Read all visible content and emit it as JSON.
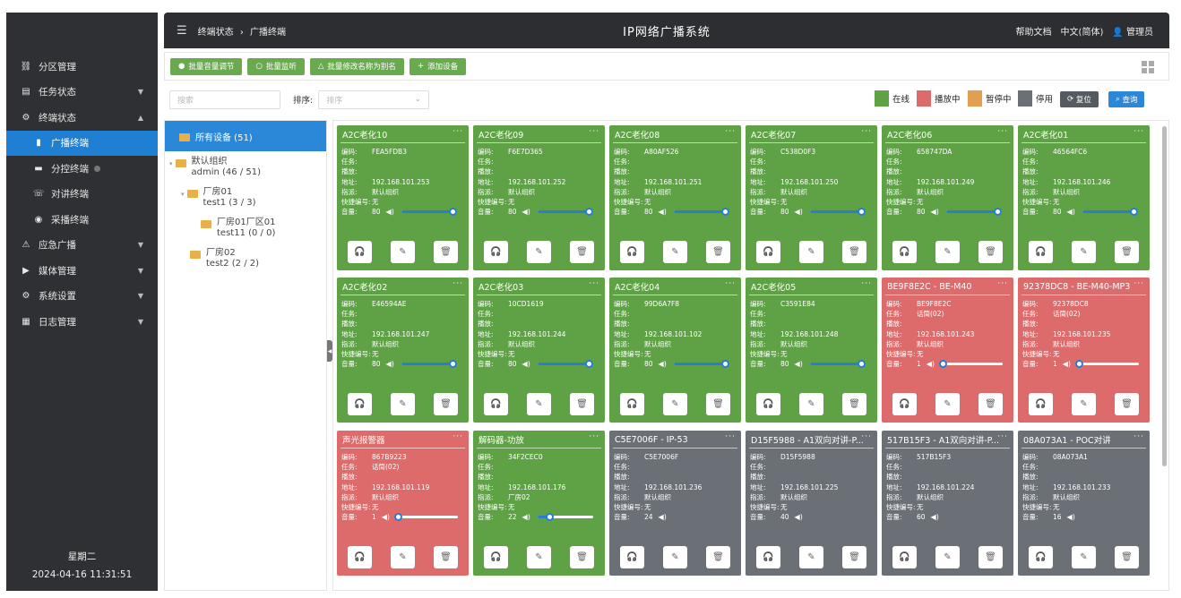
{
  "header": {
    "breadcrumb": [
      "终端状态",
      "广播终端"
    ],
    "separator": "›",
    "title": "IP网络广播系统",
    "help": "帮助文档",
    "language": "中文(简体)",
    "user": "管理员"
  },
  "sidebar": {
    "items": [
      {
        "label": "分区管理",
        "icon": "link-icon"
      },
      {
        "label": "任务状态",
        "icon": "list-icon",
        "arrow": "▼"
      },
      {
        "label": "终端状态",
        "icon": "gear-icon",
        "arrow": "▲"
      },
      {
        "label": "广播终端",
        "icon": "speaker-icon",
        "sub": true,
        "active": true
      },
      {
        "label": "分控终端",
        "icon": "monitor-icon",
        "sub": true
      },
      {
        "label": "对讲终端",
        "icon": "intercom-icon",
        "sub": true
      },
      {
        "label": "采播终端",
        "icon": "record-icon",
        "sub": true
      },
      {
        "label": "应急广播",
        "icon": "emergency-icon",
        "arrow": "▼"
      },
      {
        "label": "媒体管理",
        "icon": "media-icon",
        "arrow": "▼"
      },
      {
        "label": "系统设置",
        "icon": "settings-icon",
        "arrow": "▼"
      },
      {
        "label": "日志管理",
        "icon": "log-icon",
        "arrow": "▼"
      }
    ],
    "weekday": "星期二",
    "datetime": "2024-04-16 11:31:51"
  },
  "toolbar": {
    "buttons": [
      "批量音量调节",
      "批量监听",
      "批量修改名称为别名",
      "添加设备"
    ]
  },
  "filter": {
    "search_placeholder": "搜索",
    "sort_label": "排序:",
    "sort_placeholder": "排序",
    "legend": [
      {
        "label": "在线",
        "color": "#5fa246"
      },
      {
        "label": "播放中",
        "color": "#dd6b6b"
      },
      {
        "label": "暂停中",
        "color": "#e0a050"
      },
      {
        "label": "停用",
        "color": "#6b7077"
      }
    ],
    "reset": "复位",
    "query": "查询"
  },
  "tree": {
    "root": "所有设备 (51)",
    "nodes": [
      {
        "l1": "默认组织",
        "l2": "admin (46 / 51)"
      },
      {
        "l1": "厂房01",
        "l2": "test1 (3 / 3)"
      },
      {
        "l1": "厂房01厂区01",
        "l2": "test11 (0 / 0)"
      },
      {
        "l1": "厂房02",
        "l2": "test2 (2 / 2)"
      }
    ]
  },
  "field_labels": {
    "code": "编码:",
    "task": "任务:",
    "play": "播放:",
    "addr": "地址:",
    "group": "指派:",
    "quick": "快捷编号:",
    "volume": "音量:"
  },
  "devices": [
    {
      "title": "A2C老化10",
      "code": "FEA5FDB3",
      "task": "",
      "addr": "192.168.101.253",
      "group": "默认组织",
      "quick": "无",
      "volume": "80",
      "level": 0.92,
      "status": "green"
    },
    {
      "title": "A2C老化09",
      "code": "F6E7D365",
      "task": "",
      "addr": "192.168.101.252",
      "group": "默认组织",
      "quick": "无",
      "volume": "80",
      "level": 0.92,
      "status": "green"
    },
    {
      "title": "A2C老化08",
      "code": "A80AF526",
      "task": "",
      "addr": "192.168.101.251",
      "group": "默认组织",
      "quick": "无",
      "volume": "80",
      "level": 0.92,
      "status": "green"
    },
    {
      "title": "A2C老化07",
      "code": "C538D0F3",
      "task": "",
      "addr": "192.168.101.250",
      "group": "默认组织",
      "quick": "无",
      "volume": "80",
      "level": 0.92,
      "status": "green"
    },
    {
      "title": "A2C老化06",
      "code": "658747DA",
      "task": "",
      "addr": "192.168.101.249",
      "group": "默认组织",
      "quick": "无",
      "volume": "80",
      "level": 0.92,
      "status": "green"
    },
    {
      "title": "A2C老化01",
      "code": "46564FC6",
      "task": "",
      "addr": "192.168.101.246",
      "group": "默认组织",
      "quick": "无",
      "volume": "80",
      "level": 0.92,
      "status": "green"
    },
    {
      "title": "A2C老化02",
      "code": "E46594AE",
      "task": "",
      "addr": "192.168.101.247",
      "group": "默认组织",
      "quick": "无",
      "volume": "80",
      "level": 0.92,
      "status": "green"
    },
    {
      "title": "A2C老化03",
      "code": "10CD1619",
      "task": "",
      "addr": "192.168.101.244",
      "group": "默认组织",
      "quick": "无",
      "volume": "80",
      "level": 0.92,
      "status": "green"
    },
    {
      "title": "A2C老化04",
      "code": "99D6A7F8",
      "task": "",
      "addr": "192.168.101.102",
      "group": "默认组织",
      "quick": "无",
      "volume": "80",
      "level": 0.92,
      "status": "green"
    },
    {
      "title": "A2C老化05",
      "code": "C3591E84",
      "task": "",
      "addr": "192.168.101.248",
      "group": "默认组织",
      "quick": "无",
      "volume": "80",
      "level": 0.92,
      "status": "green"
    },
    {
      "title": "BE9F8E2C - BE-M40",
      "code": "BE9F8E2C",
      "task": "话筒(02)",
      "addr": "192.168.101.243",
      "group": "默认组织",
      "quick": "无",
      "volume": "1",
      "level": 0.01,
      "status": "red"
    },
    {
      "title": "92378DC8 - BE-M40-MP3",
      "code": "92378DC8",
      "task": "话筒(02)",
      "addr": "192.168.101.235",
      "group": "默认组织",
      "quick": "无",
      "volume": "1",
      "level": 0.01,
      "status": "red"
    },
    {
      "title": "声光报警器",
      "code": "867B9223",
      "task": "话筒(02)",
      "addr": "192.168.101.119",
      "group": "默认组织",
      "quick": "无",
      "volume": "1",
      "level": 0.01,
      "status": "red"
    },
    {
      "title": "解码器-功放",
      "code": "34F2CEC0",
      "task": "",
      "addr": "192.168.101.176",
      "group": "厂房02",
      "quick": "无",
      "volume": "22",
      "level": 0.22,
      "status": "green"
    },
    {
      "title": "C5E7006F - IP-53",
      "code": "C5E7006F",
      "task": "",
      "addr": "192.168.101.236",
      "group": "默认组织",
      "quick": "无",
      "volume": "24",
      "level": null,
      "status": "gray"
    },
    {
      "title": "D15F5988 - A1双向对讲-P...",
      "code": "D15F5988",
      "task": "",
      "addr": "192.168.101.225",
      "group": "默认组织",
      "quick": "无",
      "volume": "40",
      "level": null,
      "status": "gray"
    },
    {
      "title": "517B15F3 - A1双向对讲-P...",
      "code": "517B15F3",
      "task": "",
      "addr": "192.168.101.224",
      "group": "默认组织",
      "quick": "无",
      "volume": "60",
      "level": null,
      "status": "gray"
    },
    {
      "title": "08A073A1 - POC对讲",
      "code": "08A073A1",
      "task": "",
      "addr": "192.168.101.233",
      "group": "默认组织",
      "quick": "无",
      "volume": "16",
      "level": null,
      "status": "gray"
    }
  ]
}
